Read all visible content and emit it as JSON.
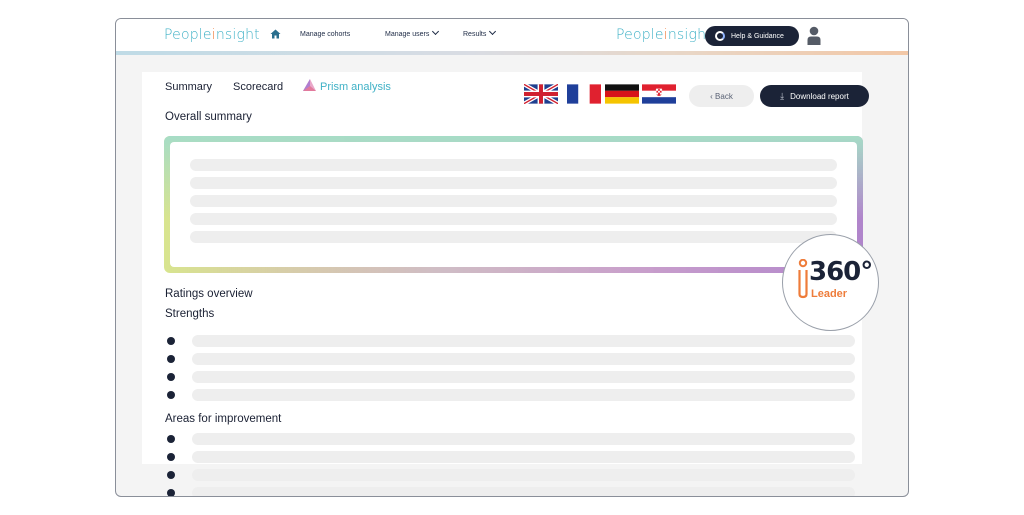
{
  "brand": {
    "logo_left_prefix": "People",
    "logo_left_accent": "i",
    "logo_left_suffix": "nsight",
    "logo_right_prefix": "People",
    "logo_right_accent": "i",
    "logo_right_suffix": "nsight",
    "primary_color": "#3fb1c6",
    "accent_color": "#ee7c3a",
    "dark_color": "#1b2337"
  },
  "nav": {
    "home_icon": "home-icon",
    "items": [
      "Manage cohorts",
      "Manage users",
      "Results"
    ],
    "help_label": "Help & Guidance",
    "user_icon": "user-icon"
  },
  "tabs": [
    "Summary",
    "Scorecard",
    "Prism analysis"
  ],
  "active_tab": "Prism analysis",
  "flags": [
    "flag-uk-icon",
    "flag-france-icon",
    "flag-germany-icon",
    "flag-croatia-icon"
  ],
  "actions": {
    "back_label": "‹ Back",
    "download_label": "Download report"
  },
  "sections": {
    "overall_summary": "Overall summary",
    "ratings_overview": "Ratings overview",
    "strengths": "Strengths",
    "areas_for_improvement": "Areas for improvement"
  },
  "badge": {
    "number": "360°",
    "subtitle": "Leader"
  }
}
